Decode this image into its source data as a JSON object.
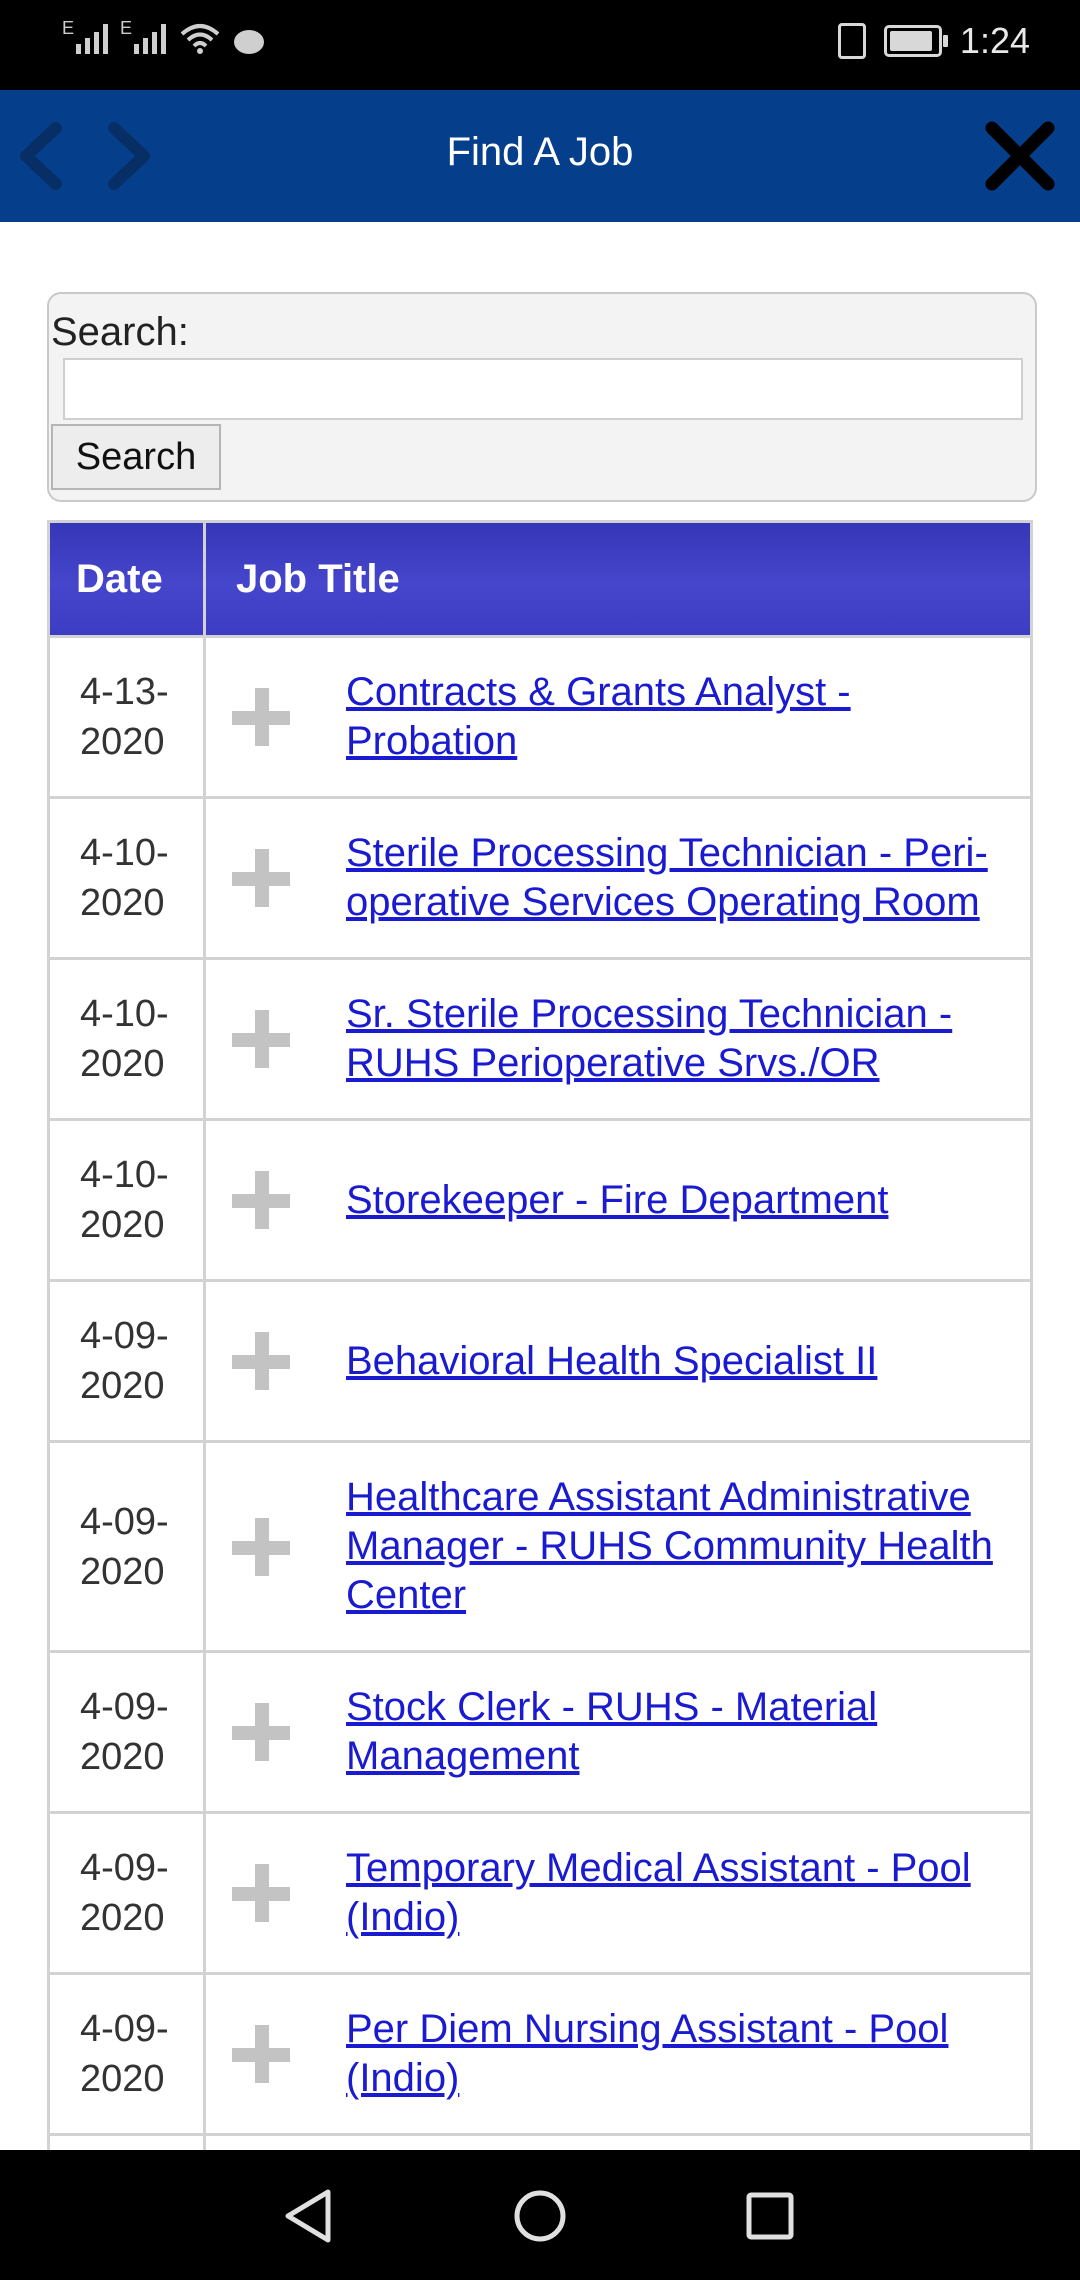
{
  "status_bar": {
    "time": "1:24",
    "signal_label": "E",
    "icons": [
      "signal-icon",
      "signal-icon",
      "wifi-icon",
      "chat-icon",
      "vibrate-icon",
      "battery-icon"
    ]
  },
  "app_bar": {
    "title": "Find A Job",
    "back_icon": "chevron-left-icon",
    "forward_icon": "chevron-right-icon",
    "close_icon": "close-icon",
    "color": "#053f8c"
  },
  "search": {
    "label": "Search:",
    "value": "",
    "button_label": "Search"
  },
  "table": {
    "headers": {
      "date": "Date",
      "title": "Job Title"
    },
    "header_color": "#4040c4",
    "rows": [
      {
        "date": "4-13-2020",
        "title": "Contracts & Grants Analyst - Probation"
      },
      {
        "date": "4-10-2020",
        "title": "Sterile Processing Technician - Peri-operative Services Operating Room"
      },
      {
        "date": "4-10-2020",
        "title": "Sr. Sterile Processing Technician - RUHS Perioperative Srvs./OR"
      },
      {
        "date": "4-10-2020",
        "title": "Storekeeper - Fire Department"
      },
      {
        "date": "4-09-2020",
        "title": "Behavioral Health Specialist II"
      },
      {
        "date": "4-09-2020",
        "title": "Healthcare Assistant Administrative Manager - RUHS Community Health Center"
      },
      {
        "date": "4-09-2020",
        "title": "Stock Clerk - RUHS - Material Management"
      },
      {
        "date": "4-09-2020",
        "title": "Temporary Medical Assistant - Pool (Indio)"
      },
      {
        "date": "4-09-2020",
        "title": "Per Diem Nursing Assistant - Pool (Indio)"
      }
    ],
    "row_icon": "plus-icon",
    "link_color": "#1a1ad0"
  },
  "nav_bar": {
    "icons": [
      "back-triangle-icon",
      "home-circle-icon",
      "recents-square-icon"
    ]
  }
}
